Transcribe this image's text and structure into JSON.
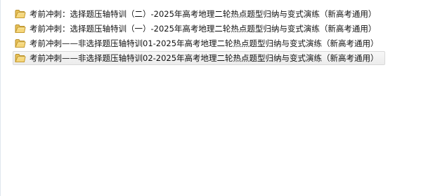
{
  "colors": {
    "background": "#ffffff",
    "text": "#111111",
    "selection": "#ececec",
    "folder": "#e8c55a"
  },
  "file_list": {
    "items": [
      {
        "icon": "folder-icon",
        "name": "考前冲刺：选择题压轴特训（二）-2025年高考地理二轮热点题型归纳与变式演练（新高考通用）",
        "selected": false
      },
      {
        "icon": "folder-icon",
        "name": "考前冲刺：选择题压轴特训（一）-2025年高考地理二轮热点题型归纳与变式演练（新高考通用）",
        "selected": false
      },
      {
        "icon": "folder-icon",
        "name": "考前冲刺——非选择题压轴特训01-2025年高考地理二轮热点题型归纳与变式演练（新高考通用）",
        "selected": false
      },
      {
        "icon": "folder-icon",
        "name": "考前冲刺——非选择题压轴特训02-2025年高考地理二轮热点题型归纳与变式演练（新高考通用）",
        "selected": true
      }
    ]
  }
}
